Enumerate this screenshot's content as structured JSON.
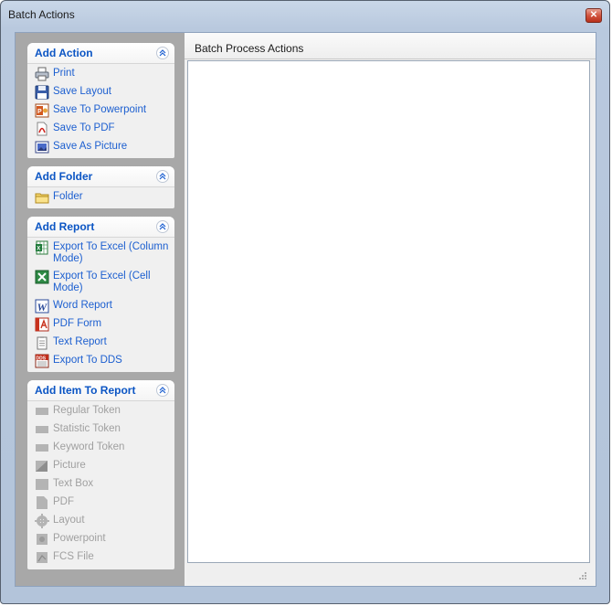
{
  "window": {
    "title": "Batch Actions"
  },
  "main": {
    "header": "Batch Process Actions"
  },
  "groups": [
    {
      "title": "Add Action",
      "items": [
        {
          "label": "Print",
          "icon": "printer-icon"
        },
        {
          "label": "Save Layout",
          "icon": "floppy-disk-icon"
        },
        {
          "label": "Save To Powerpoint",
          "icon": "powerpoint-icon"
        },
        {
          "label": "Save To PDF",
          "icon": "pdf-icon"
        },
        {
          "label": "Save As Picture",
          "icon": "picture-icon"
        }
      ]
    },
    {
      "title": "Add Folder",
      "items": [
        {
          "label": "Folder",
          "icon": "folder-icon"
        }
      ]
    },
    {
      "title": "Add Report",
      "items": [
        {
          "label": "Export To Excel (Column Mode)",
          "icon": "excel-column-icon"
        },
        {
          "label": "Export To Excel (Cell Mode)",
          "icon": "excel-cell-icon"
        },
        {
          "label": "Word Report",
          "icon": "word-icon"
        },
        {
          "label": "PDF Form",
          "icon": "pdf-form-icon"
        },
        {
          "label": "Text Report",
          "icon": "text-report-icon"
        },
        {
          "label": "Export To DDS",
          "icon": "dds-icon"
        }
      ]
    },
    {
      "title": "Add Item To Report",
      "items": [
        {
          "label": "Regular Token",
          "icon": "regular-token-icon"
        },
        {
          "label": "Statistic Token",
          "icon": "statistic-token-icon"
        },
        {
          "label": "Keyword Token",
          "icon": "keyword-token-icon"
        },
        {
          "label": "Picture",
          "icon": "picture-item-icon"
        },
        {
          "label": "Text Box",
          "icon": "text-box-icon"
        },
        {
          "label": "PDF",
          "icon": "pdf-item-icon"
        },
        {
          "label": "Layout",
          "icon": "layout-item-icon"
        },
        {
          "label": "Powerpoint",
          "icon": "powerpoint-item-icon"
        },
        {
          "label": "FCS File",
          "icon": "fcs-file-icon"
        }
      ]
    }
  ]
}
